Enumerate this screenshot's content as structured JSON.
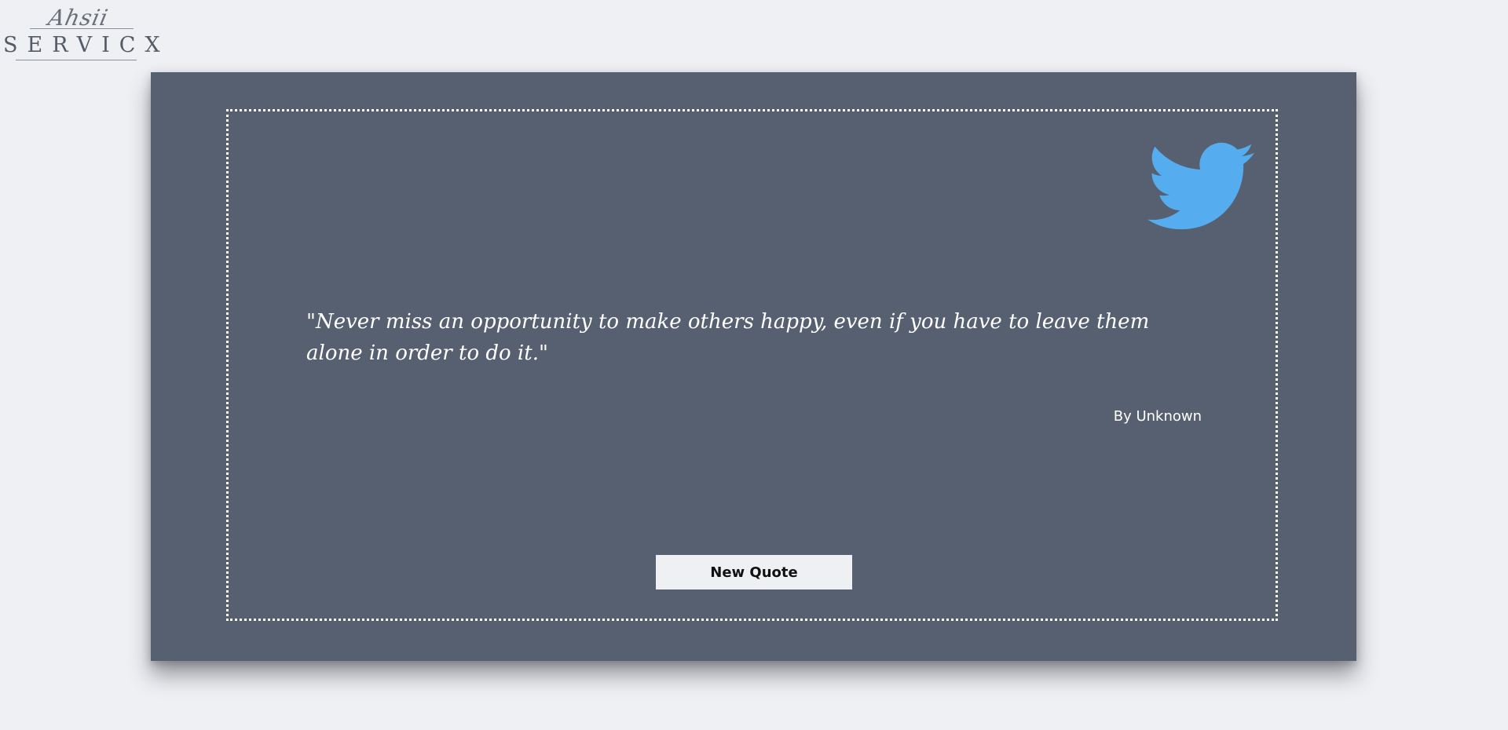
{
  "logo": {
    "script": "Ahsii",
    "word": "SERVICX"
  },
  "quote": {
    "text": "\"Never miss an opportunity to make others happy, even if you have to leave them alone in order to do it.\"",
    "author": "By Unknown"
  },
  "buttons": {
    "new_quote_label": "New Quote",
    "tweet_icon": "twitter-bird-icon"
  },
  "colors": {
    "page_background": "#eff0f4",
    "card_background": "#566070",
    "twitter_blue": "#55acee",
    "text": "#ffffff"
  }
}
